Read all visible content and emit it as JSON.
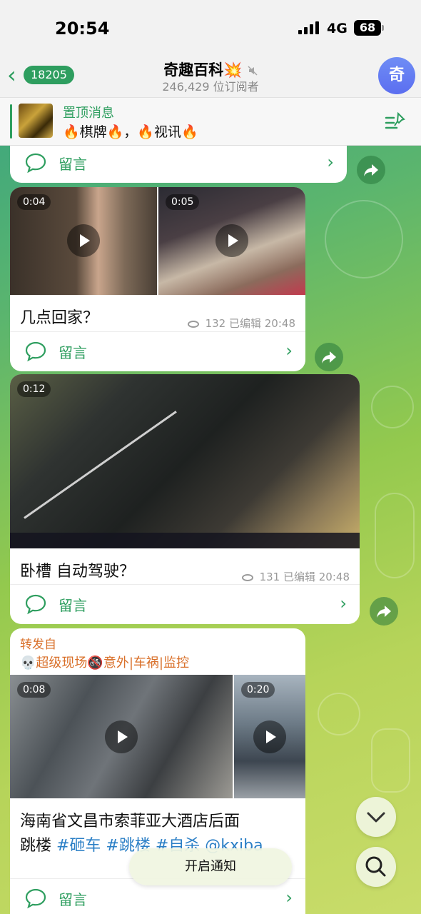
{
  "status": {
    "time": "20:54",
    "network": "4G",
    "battery": "68"
  },
  "header": {
    "back_count": "18205",
    "title": "奇趣百科💥",
    "subscribers": "246,429 位订阅者",
    "avatar_text": "奇"
  },
  "pinned": {
    "title": "置顶消息",
    "text": "🔥棋牌🔥，🔥视讯🔥"
  },
  "posts": [
    {
      "comment_label": "留言"
    },
    {
      "durations": [
        "0:04",
        "0:05"
      ],
      "caption": "几点回家？",
      "views": "132",
      "meta": "已编辑 20:48",
      "comment_label": "留言"
    },
    {
      "durations": [
        "0:12"
      ],
      "caption": "卧槽 自动驾驶？",
      "views": "131",
      "meta": "已编辑 20:48",
      "comment_label": "留言"
    },
    {
      "forward_label": "转发自",
      "forward_source": "💀超级现场🚳意外|车祸|监控",
      "durations": [
        "0:08",
        "0:20"
      ],
      "caption_line1": "海南省文昌市索菲亚大酒店后面",
      "caption_line2_plain": "跳楼 ",
      "caption_tags": "#砸车 #跳楼 #自杀 @kxiba",
      "comment_label": "留言"
    }
  ],
  "bottom": {
    "notify_label": "开启通知"
  },
  "colors": {
    "accent": "#2e9e5f",
    "forward": "#d9702a",
    "link": "#2b7fc6"
  },
  "icons": [
    "back-chevron-icon",
    "mute-icon",
    "pin-list-icon",
    "comment-icon",
    "chevron-right-icon",
    "play-icon",
    "eye-icon",
    "share-icon",
    "chevron-down-icon",
    "search-icon"
  ]
}
